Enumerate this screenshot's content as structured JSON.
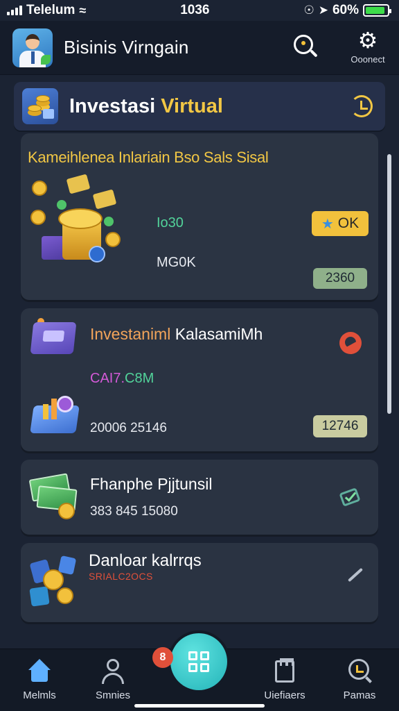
{
  "status_bar": {
    "carrier": "Telelum",
    "time": "1036",
    "battery": "60%",
    "battery_level": 0.9
  },
  "header": {
    "app_title": "Bisinis Virngain",
    "settings_label": "Ooonect"
  },
  "section": {
    "title_main": "Investasi",
    "title_accent": "Virtual"
  },
  "cards": [
    {
      "kicker": "Kameihlenea Inlariain Bso Sals Sisal",
      "metric_a": "Io30",
      "metric_b": "MG0K",
      "badge": "OK",
      "percent": "2360"
    },
    {
      "title_a": "Investaniml",
      "title_b": "KalasamiMh",
      "code_a": "CAI7.",
      "code_b": "C8M",
      "numbers": "20006 25146",
      "percent": "12746"
    },
    {
      "title": "Fhanphe Pjjtunsil",
      "numbers": "383 845 15080"
    },
    {
      "title": "Danloar kalrrqs",
      "sub": "SRIALC2OCS"
    }
  ],
  "nav": {
    "home": "Melmls",
    "users": "Smnies",
    "files": "Uiefiaers",
    "reports": "Pamas",
    "fab_badge": "8"
  },
  "colors": {
    "background": "#1b2333",
    "accent_gold": "#f2c744",
    "accent_teal": "#23b3b8",
    "alert_red": "#e0503a"
  }
}
